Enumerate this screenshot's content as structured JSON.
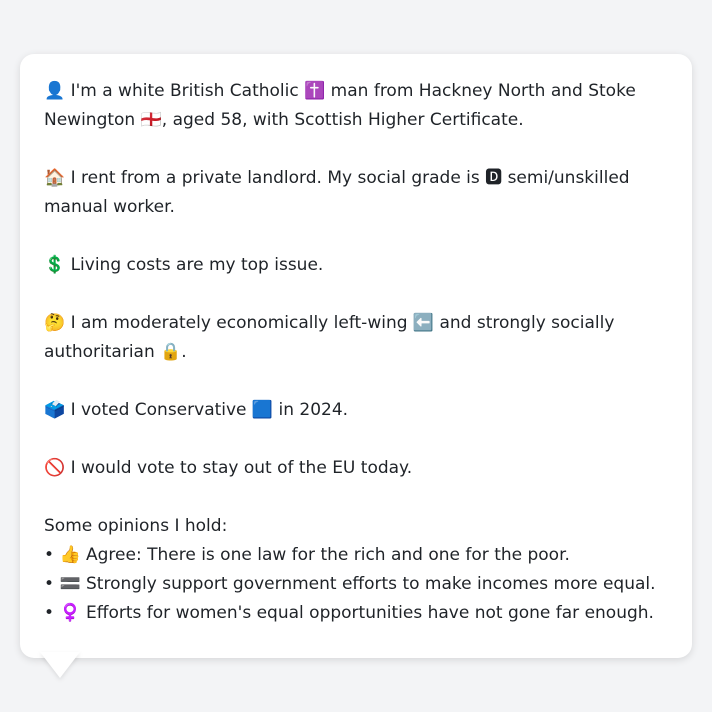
{
  "profile": {
    "identity_emoji": "👤",
    "identity_text": "I'm a white British Catholic ✝️ man from Hackney North and Stoke Newington 🏴󠁧󠁢󠁥󠁮󠁧󠁿, aged 58, with Scottish Higher Certificate.",
    "housing_emoji": "🏠",
    "housing_text": "I rent from a private landlord. My social grade is 🅳 semi/unskilled manual worker.",
    "issue_emoji": "💲",
    "issue_text": "Living costs are my top issue.",
    "ideology_emoji": "🤔",
    "ideology_text": "I am moderately economically left-wing ⬅️ and strongly socially authoritarian 🔒.",
    "vote_emoji": "🗳️",
    "vote_text": "I voted Conservative 🟦 in 2024.",
    "eu_emoji": "🚫",
    "eu_text": "I would vote to stay out of the EU today."
  },
  "opinions": {
    "heading": "Some opinions I hold:",
    "items": [
      {
        "bullet": "•",
        "emoji": "👍",
        "text": "Agree: There is one law for the rich and one for the poor."
      },
      {
        "bullet": "•",
        "emoji": "🟰",
        "text": "Strongly support government efforts to make incomes more equal."
      },
      {
        "bullet": "•",
        "emoji": "♀️",
        "text": "Efforts for women's equal opportunities have not gone far enough."
      }
    ]
  },
  "colors": {
    "background": "#f3f4f6",
    "bubble": "#ffffff",
    "text": "#1f2328"
  }
}
